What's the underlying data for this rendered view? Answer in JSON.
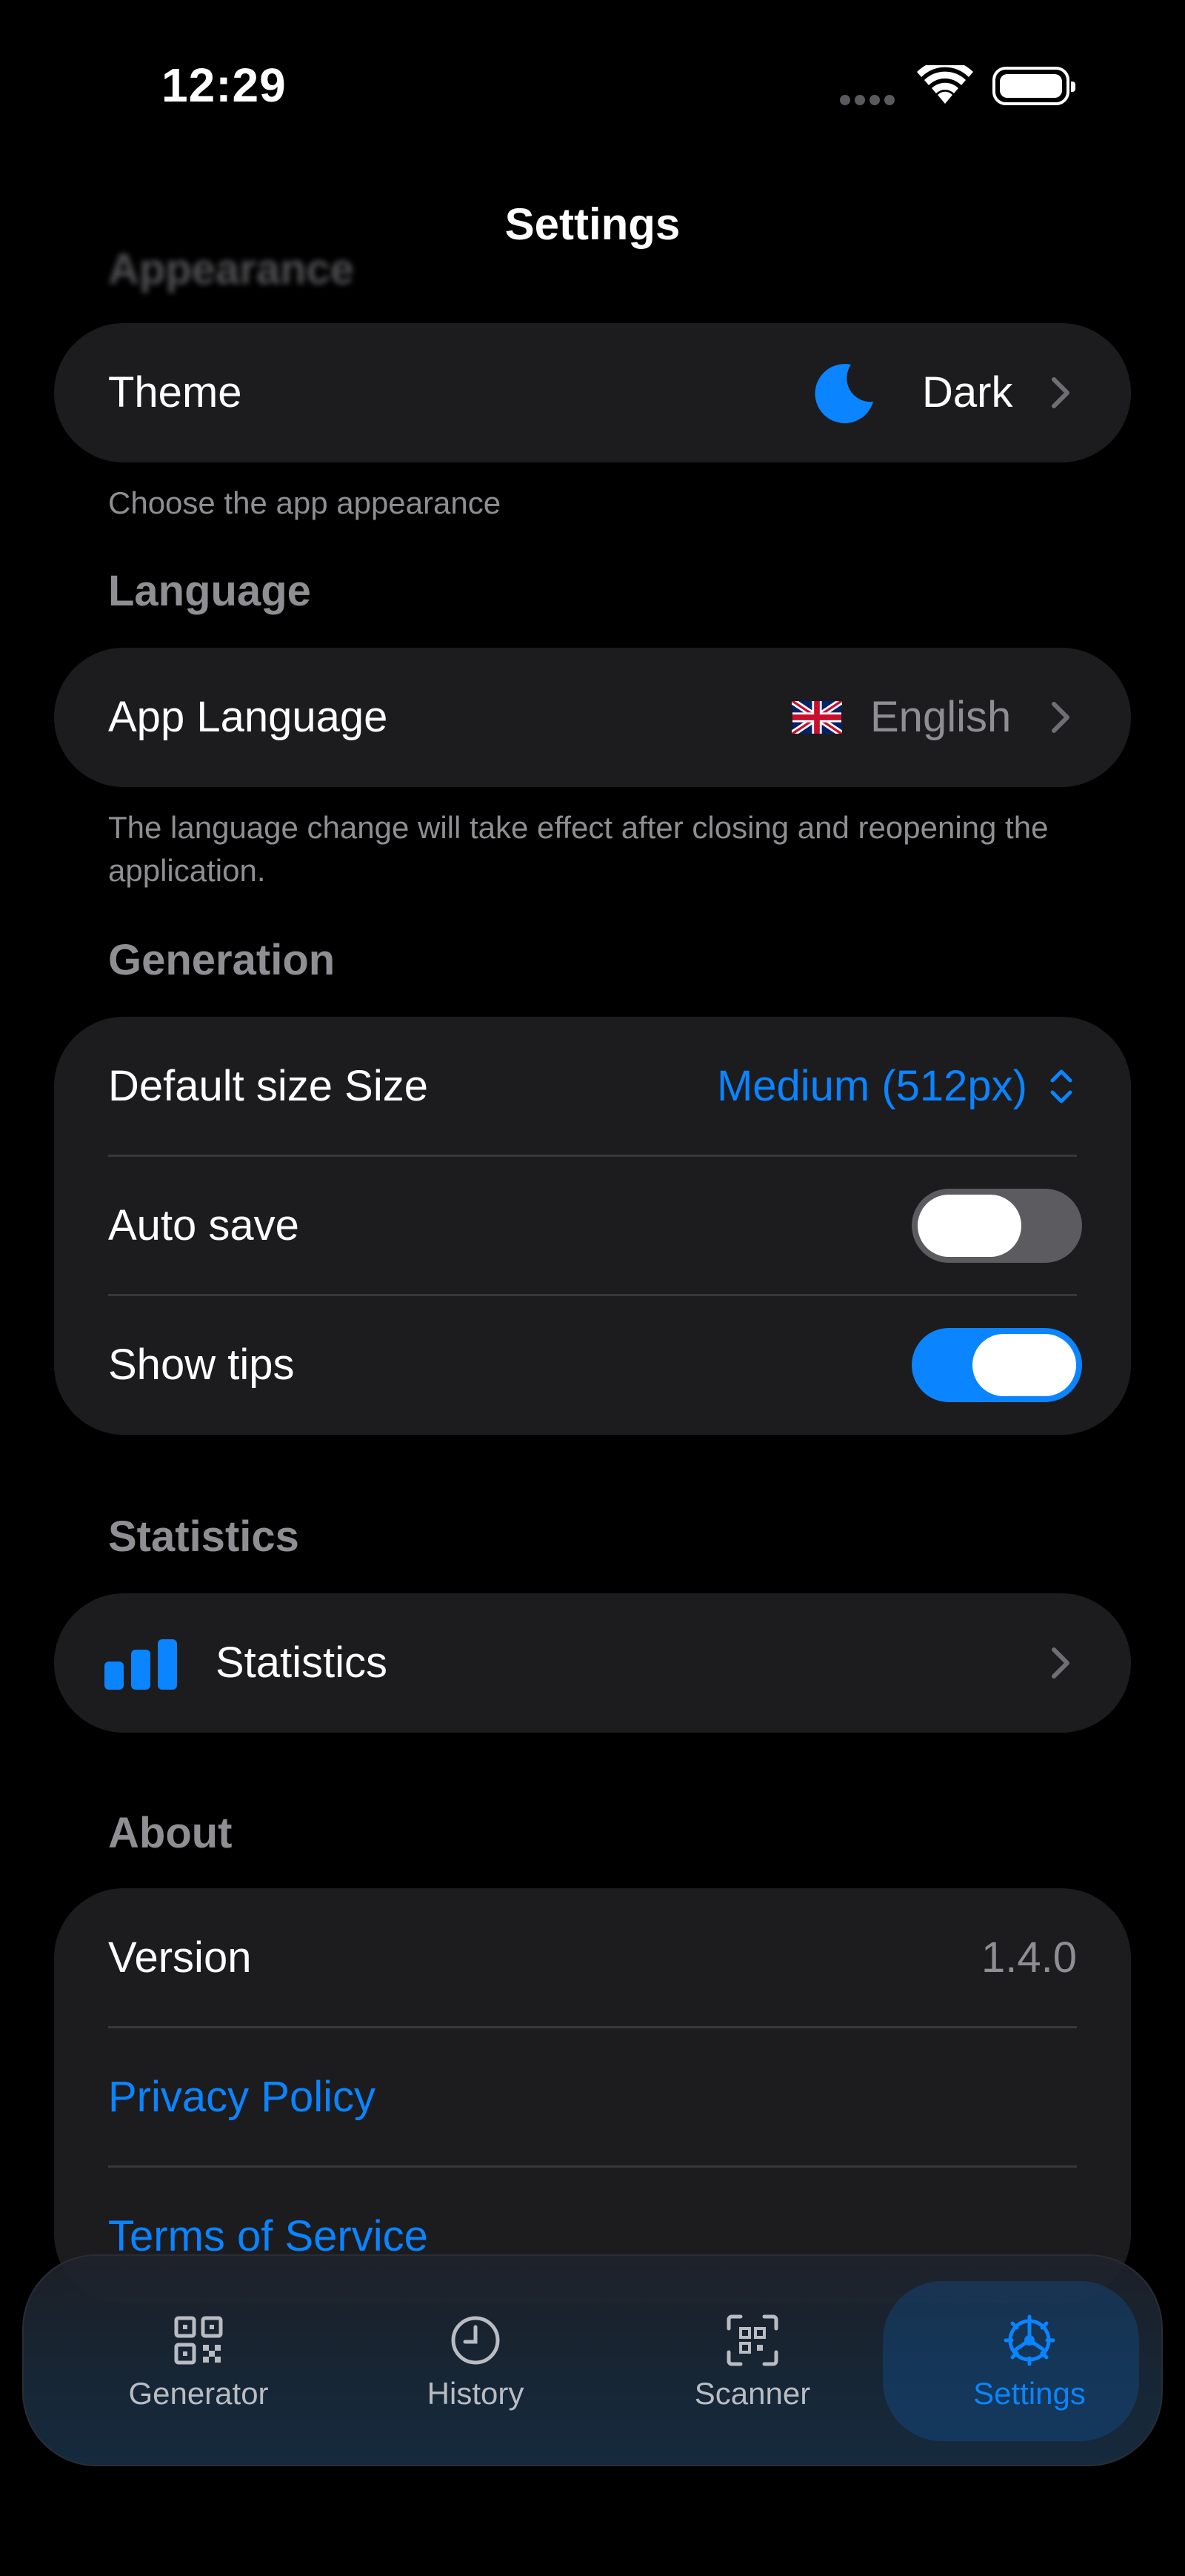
{
  "status_bar": {
    "time": "12:29"
  },
  "nav": {
    "title": "Settings"
  },
  "appearance": {
    "header": "Appearance",
    "theme_label": "Theme",
    "theme_value": "Dark",
    "theme_icon": "moon-icon",
    "footnote": "Choose the app appearance"
  },
  "language": {
    "header": "Language",
    "label": "App Language",
    "value": "English",
    "flag_icon": "uk-flag-icon",
    "footnote": "The language change will take effect after closing and reopening the application."
  },
  "generation": {
    "header": "Generation",
    "default_size_label": "Default size  Size",
    "default_size_value": "Medium (512px)",
    "auto_save_label": "Auto save",
    "auto_save_on": false,
    "show_tips_label": "Show tips",
    "show_tips_on": true
  },
  "statistics": {
    "header": "Statistics",
    "label": "Statistics",
    "icon": "bar-chart-icon"
  },
  "about": {
    "header": "About",
    "version_label": "Version",
    "version_value": "1.4.0",
    "privacy_label": "Privacy Policy",
    "terms_label": "Terms of Service"
  },
  "tabbar": {
    "tabs": [
      {
        "label": "Generator",
        "icon": "qr-code-icon",
        "active": false
      },
      {
        "label": "History",
        "icon": "clock-icon",
        "active": false
      },
      {
        "label": "Scanner",
        "icon": "qr-scan-icon",
        "active": false
      },
      {
        "label": "Settings",
        "icon": "gear-icon",
        "active": true
      }
    ]
  },
  "colors": {
    "accent": "#0a84ff",
    "background": "#000000",
    "card": "#1c1c1e",
    "secondary_text": "#8e8e93"
  }
}
